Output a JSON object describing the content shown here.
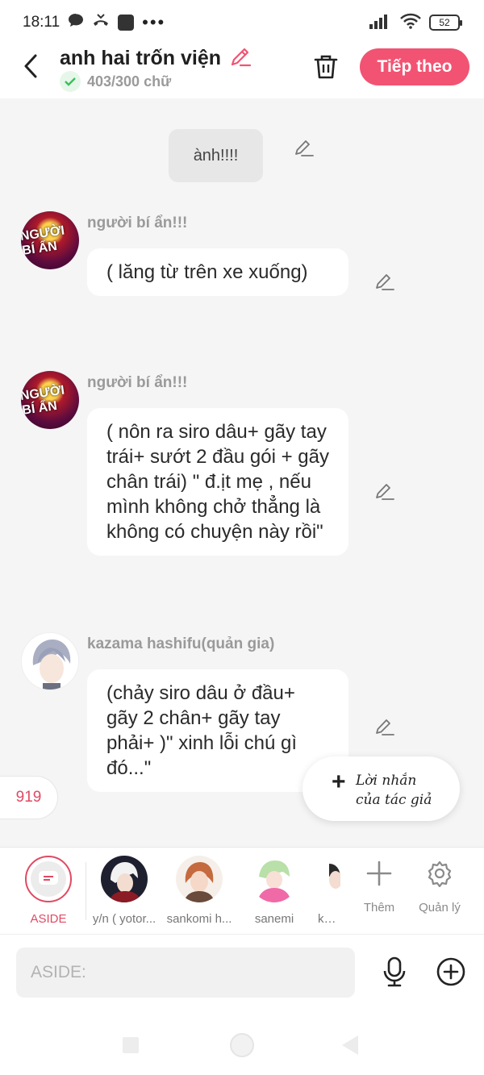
{
  "status_bar": {
    "time": "18:11",
    "icons": [
      "chat-bubble-icon",
      "missed-call-icon",
      "app-icon",
      "more-icon"
    ],
    "battery": "52"
  },
  "header": {
    "title": "anh hai trốn viện",
    "word_count": "403/300 chữ",
    "next_label": "Tiếp theo",
    "accent_color": "#f25372"
  },
  "chat": {
    "aside_text": "ành!!!!",
    "messages": [
      {
        "name": "người bí ẩn!!!",
        "avatar_text": "NGƯỜI BÍ ẨN",
        "text": "( lăng từ trên xe xuống)"
      },
      {
        "name": "người bí ẩn!!!",
        "avatar_text": "NGƯỜI BÍ ẨN",
        "text": "( nôn ra siro dâu+ gãy tay trái+ sướt 2 đầu gói + gãy chân trái) \" đ.ịt mẹ , nếu mình không chở thẳng là không có chuyện này rồi\""
      },
      {
        "name": "kazama hashifu(quản gia)",
        "text": "(chảy siro dâu ở đầu+ gãy 2 chân+ gãy tay phải+ )\" xinh lỗi chú gì đó...\""
      }
    ],
    "count_badge": "919",
    "author_note_label": "Lời nhắn của tác giả"
  },
  "character_bar": {
    "items": [
      {
        "label": "ASIDE"
      },
      {
        "label": "y/n ( yotor..."
      },
      {
        "label": "sankomi h..."
      },
      {
        "label": "sanemi"
      },
      {
        "label": "kata"
      }
    ],
    "add_label": "Thêm",
    "manage_label": "Quản lý"
  },
  "input": {
    "placeholder": "ASIDE:"
  }
}
